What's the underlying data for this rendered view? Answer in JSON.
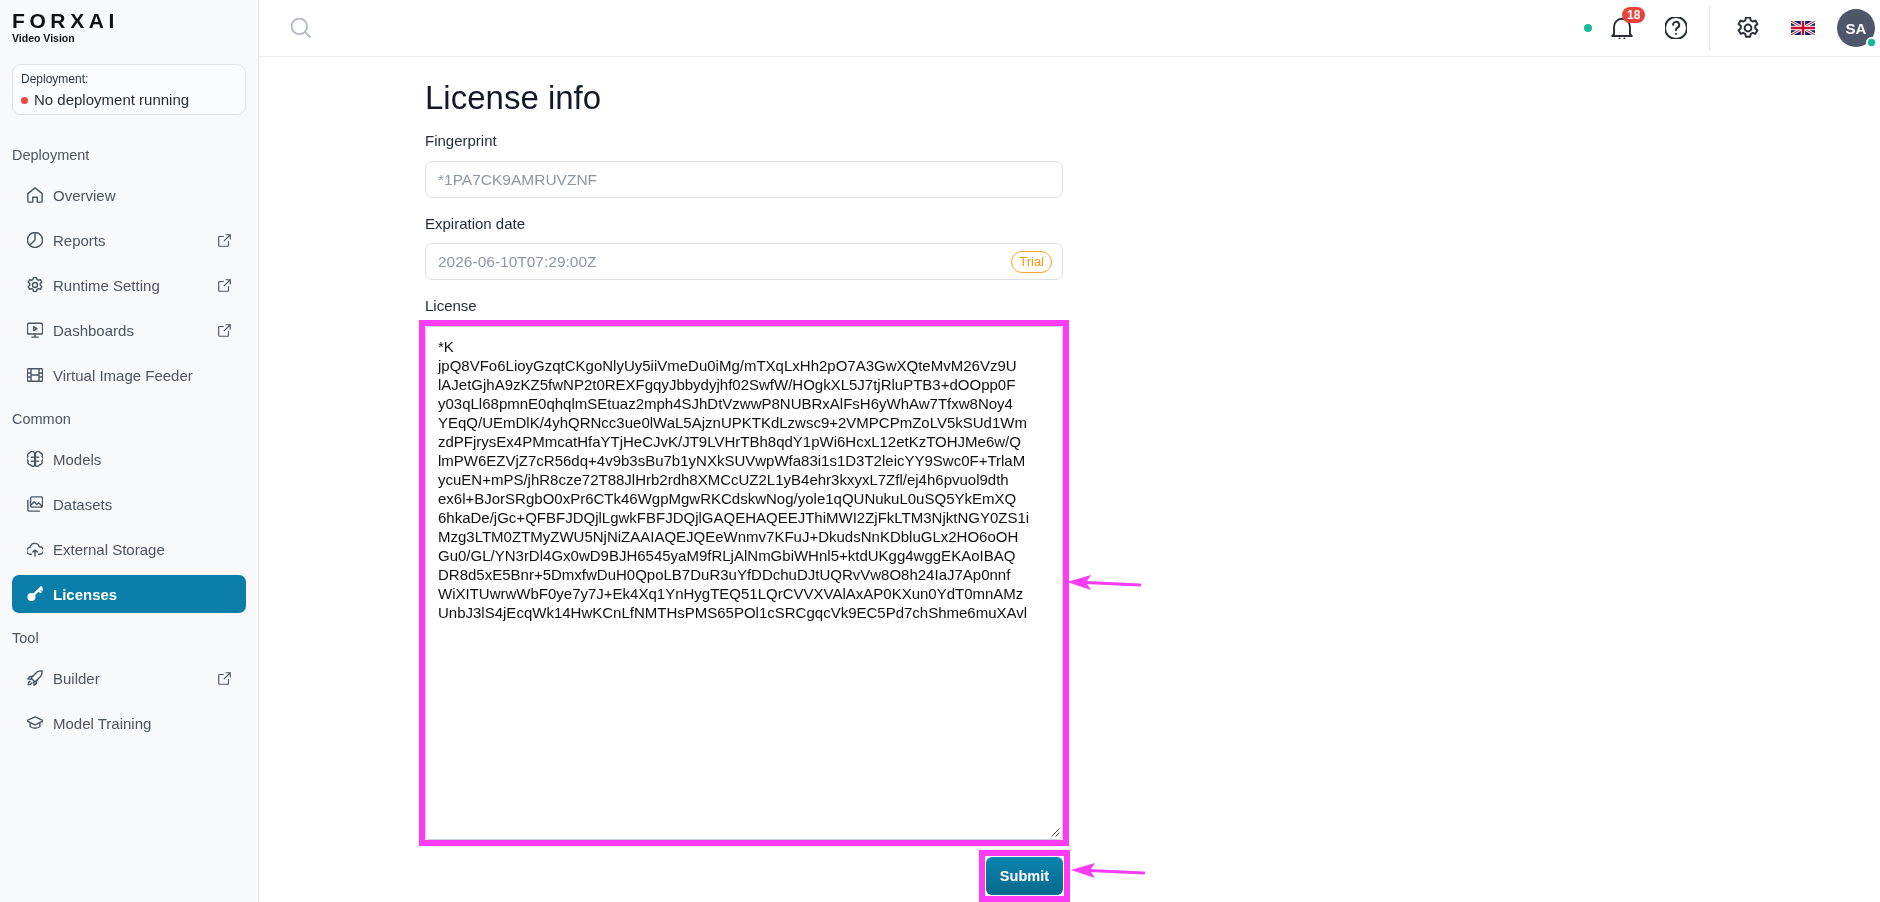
{
  "sidebar": {
    "logo": {
      "brand": "FORXAI",
      "product": "Video Vision"
    },
    "deployment": {
      "label": "Deployment:",
      "status": "No deployment running",
      "running": false
    },
    "sections": [
      {
        "title": "Deployment",
        "items": [
          {
            "label": "Overview",
            "external": false,
            "selected": false
          },
          {
            "label": "Reports",
            "external": true,
            "selected": false
          },
          {
            "label": "Runtime Setting",
            "external": true,
            "selected": false
          },
          {
            "label": "Dashboards",
            "external": true,
            "selected": false
          },
          {
            "label": "Virtual Image Feeder",
            "external": false,
            "selected": false
          }
        ]
      },
      {
        "title": "Common",
        "items": [
          {
            "label": "Models",
            "external": false,
            "selected": false
          },
          {
            "label": "Datasets",
            "external": false,
            "selected": false
          },
          {
            "label": "External Storage",
            "external": false,
            "selected": false
          },
          {
            "label": "Licenses",
            "external": false,
            "selected": true
          }
        ]
      },
      {
        "title": "Tool",
        "items": [
          {
            "label": "Builder",
            "external": true,
            "selected": false
          },
          {
            "label": "Model Training",
            "external": false,
            "selected": false
          }
        ]
      }
    ]
  },
  "topbar": {
    "connected": true,
    "notifications": "18",
    "avatar": {
      "initials": "SA",
      "online": true
    }
  },
  "form": {
    "title": "License info",
    "fields": [
      {
        "kind": "input",
        "label": "Fingerprint",
        "value": "*1PA7CK9AMRUVZNF",
        "disabled": true
      },
      {
        "kind": "input",
        "label": "Expiration date",
        "value": "2026-06-10T07:29:00Z",
        "disabled": true,
        "badge": "Trial"
      },
      {
        "kind": "textarea",
        "label": "License",
        "value": "*K\njpQ8VFo6LioyGzqtCKgoNlyUy5iiVmeDu0iMg/mTXqLxHh2pO7A3GwXQteMvM26Vz9U\nlAJetGjhA9zKZ5fwNP2t0REXFgqyJbbydyjhf02SwfW/HOgkXL5J7tjRluPTB3+dOOpp0F\ny03qLl68pmnE0qhqlmSEtuaz2mph4SJhDtVzwwP8NUBRxAlFsH6yWhAw7Tfxw8Noy4\nYEqQ/UEmDlK/4yhQRNcc3ue0lWaL5AjznUPKTKdLzwsc9+2VMPCPmZoLV5kSUd1Wm\nzdPFjrysEx4PMmcatHfaYTjHeCJvK/JT9LVHrTBh8qdY1pWi6HcxL12etKzTOHJMe6w/Q\nlmPW6EZVjZ7cR56dq+4v9b3sBu7b1yNXkSUVwpWfa83i1s1D3T2leicYY9Swc0F+TrlaM\nycuEN+mPS/jhR8cze72T88JlHrb2rdh8XMCcUZ2L1yB4ehr3kxyxL7Zfl/ej4h6pvuol9dth\nex6l+BJorSRgbO0xPr6CTk46WgpMgwRKCdskwNog/yole1qQUNukuL0uSQ5YkEmXQ\n6hkaDe/jGc+QFBFJDQjlLgwkFBFJDQjlGAQEHAQEEJThiMWI2ZjFkLTM3NjktNGY0ZS1i\nMzg3LTM0ZTMyZWU5NjNiZAAIAQEJQEeWnmv7KFuJ+DkudsNnKDbluGLx2HO6oOH\nGu0/GL/YN3rDl4Gx0wD9BJH6545yaM9fRLjAlNmGbiWHnl5+ktdUKgg4wggEKAoIBAQ\nDR8d5xE5Bnr+5DmxfwDuH0QpoLB7DuR3uYfDDchuDJtUQRvVw8O8h24IaJ7Ap0nnf\nWiXITUwrwWbF0ye7y7J+Ek4Xq1YnHygTEQ51LQrCVVXVAlAxAP0KXun0YdT0mnAMz\nUnbJ3lS4jEcqWk14HwKCnLfNMTHsPMS65POl1cSRCgqcVk9EC5Pd7chShme6muXAvl",
        "disabled": false,
        "highlighted": true
      }
    ],
    "submit": {
      "label": "Submit",
      "highlighted": true
    }
  }
}
